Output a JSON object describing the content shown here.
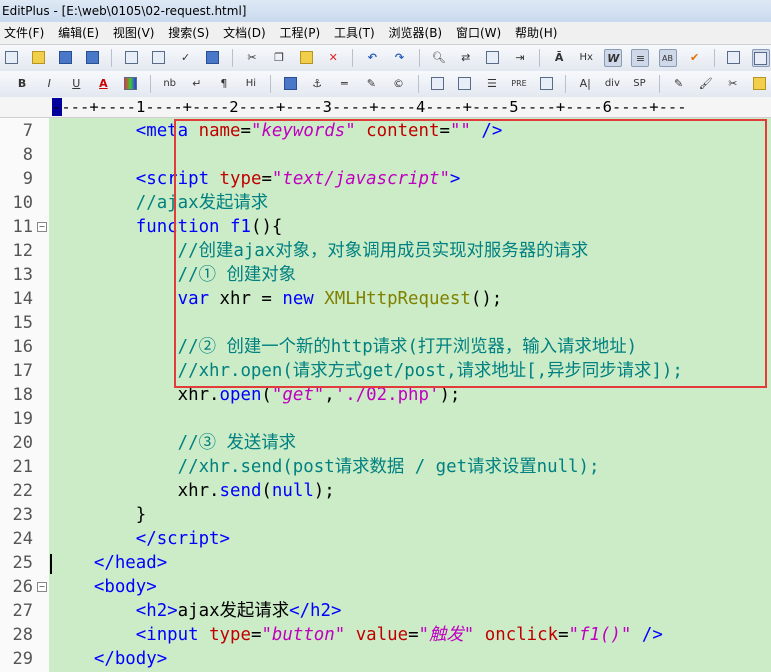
{
  "window": {
    "title": "EditPlus - [E:\\web\\0105\\02-request.html]"
  },
  "menubar": {
    "items": [
      "文件(F)",
      "编辑(E)",
      "视图(V)",
      "搜索(S)",
      "文档(D)",
      "工程(P)",
      "工具(T)",
      "浏览器(B)",
      "窗口(W)",
      "帮助(H)"
    ]
  },
  "toolbar1": {
    "icons": [
      "new-file-icon",
      "open-file-icon",
      "save-icon",
      "save-all-icon",
      "sep",
      "print-icon",
      "print-preview-icon",
      "spell-check-icon",
      "browser-preview-icon",
      "sep",
      "cut-icon",
      "copy-icon",
      "paste-icon",
      "delete-icon",
      "sep",
      "undo-icon",
      "redo-icon",
      "sep",
      "find-icon",
      "replace-icon",
      "find-in-files-icon",
      "goto-icon",
      "sep",
      "font-icon",
      "hex-icon",
      "word-wrap-icon",
      "line-number-icon",
      "column-select-icon",
      "check-icon",
      "sep",
      "view-list-icon",
      "view-active-icon",
      "view-toggle-icon",
      "new-window-icon",
      "sep",
      "whats-this-icon"
    ],
    "labels": {
      "font": "Ā",
      "hex": "Hx",
      "word_wrap": "W",
      "column": "AB"
    }
  },
  "toolbar2": {
    "labels": {
      "bold": "B",
      "italic": "I",
      "underline": "U",
      "font_color": "A",
      "nbsp": "nb",
      "line_break": "↵",
      "paragraph": "¶",
      "heading": "Hi",
      "pre": "PRE",
      "div": "div",
      "span": "SP"
    }
  },
  "ruler": {
    "text": "----+----1----+----2----+----3----+----4----+----5----+----6----+---"
  },
  "editor": {
    "current_line": 25,
    "lines": [
      {
        "n": "7",
        "fold": "",
        "html": "        <span class=\"tag\">&lt;meta</span> <span class=\"attr\">name</span>=<span class=\"str\">\"keywords\"</span> <span class=\"attr\">content</span>=<span class=\"str\">\"\"</span> <span class=\"tag\">/&gt;</span>"
      },
      {
        "n": "8",
        "fold": "",
        "html": ""
      },
      {
        "n": "9",
        "fold": "",
        "html": "        <span class=\"tag\">&lt;script</span> <span class=\"attr\">type</span>=<span class=\"str\">\"text/javascript\"</span><span class=\"tag\">&gt;</span>"
      },
      {
        "n": "10",
        "fold": "",
        "html": "        <span class=\"cm\">//ajax发起请求</span>"
      },
      {
        "n": "11",
        "fold": "⊟",
        "html": "        <span class=\"kw\">function</span> <span class=\"fn\">f1</span>(){"
      },
      {
        "n": "12",
        "fold": "",
        "html": "            <span class=\"cm\">//创建ajax对象，对象调用成员实现对服务器的请求</span>"
      },
      {
        "n": "13",
        "fold": "",
        "html": "            <span class=\"cm\">//① 创建对象</span>"
      },
      {
        "n": "14",
        "fold": "",
        "html": "            <span class=\"kw\">var</span> xhr = <span class=\"kw\">new</span> <span class=\"cls\">XMLHttpRequest</span>();"
      },
      {
        "n": "15",
        "fold": "",
        "html": ""
      },
      {
        "n": "16",
        "fold": "",
        "html": "            <span class=\"cm\">//② 创建一个新的http请求(打开浏览器，输入请求地址)</span>"
      },
      {
        "n": "17",
        "fold": "",
        "html": "            <span class=\"cm\">//xhr.open(请求方式get/post,请求地址[,异步同步请求]);</span>"
      },
      {
        "n": "18",
        "fold": "",
        "html": "            xhr.<span class=\"fn\">open</span>(<span class=\"str\">\"get\"</span>,<span class=\"sq\">'./02.php'</span>);"
      },
      {
        "n": "19",
        "fold": "",
        "html": ""
      },
      {
        "n": "20",
        "fold": "",
        "html": "            <span class=\"cm\">//③ 发送请求</span>"
      },
      {
        "n": "21",
        "fold": "",
        "html": "            <span class=\"cm\">//xhr.send(post请求数据 / get请求设置null);</span>"
      },
      {
        "n": "22",
        "fold": "",
        "html": "            xhr.<span class=\"fn\">send</span>(<span class=\"kw\">null</span>);"
      },
      {
        "n": "23",
        "fold": "",
        "html": "        }"
      },
      {
        "n": "24",
        "fold": "",
        "html": "        <span class=\"tag\">&lt;/script&gt;</span>"
      },
      {
        "n": "25",
        "fold": "",
        "html": "    <span class=\"tag\">&lt;/head&gt;</span>"
      },
      {
        "n": "26",
        "fold": "⊟",
        "html": "    <span class=\"tag\">&lt;body&gt;</span>"
      },
      {
        "n": "27",
        "fold": "",
        "html": "        <span class=\"tag\">&lt;h2&gt;</span>ajax发起请求<span class=\"tag\">&lt;/h2&gt;</span>"
      },
      {
        "n": "28",
        "fold": "",
        "html": "        <span class=\"tag\">&lt;input</span> <span class=\"attr\">type</span>=<span class=\"str\">\"button\"</span> <span class=\"attr\">value</span>=<span class=\"str\">\"触发\"</span> <span class=\"attr\">onclick</span>=<span class=\"str\">\"f1()\"</span> <span class=\"tag\">/&gt;</span>"
      },
      {
        "n": "29",
        "fold": "",
        "html": "    <span class=\"tag\">&lt;/body&gt;</span>"
      }
    ]
  }
}
